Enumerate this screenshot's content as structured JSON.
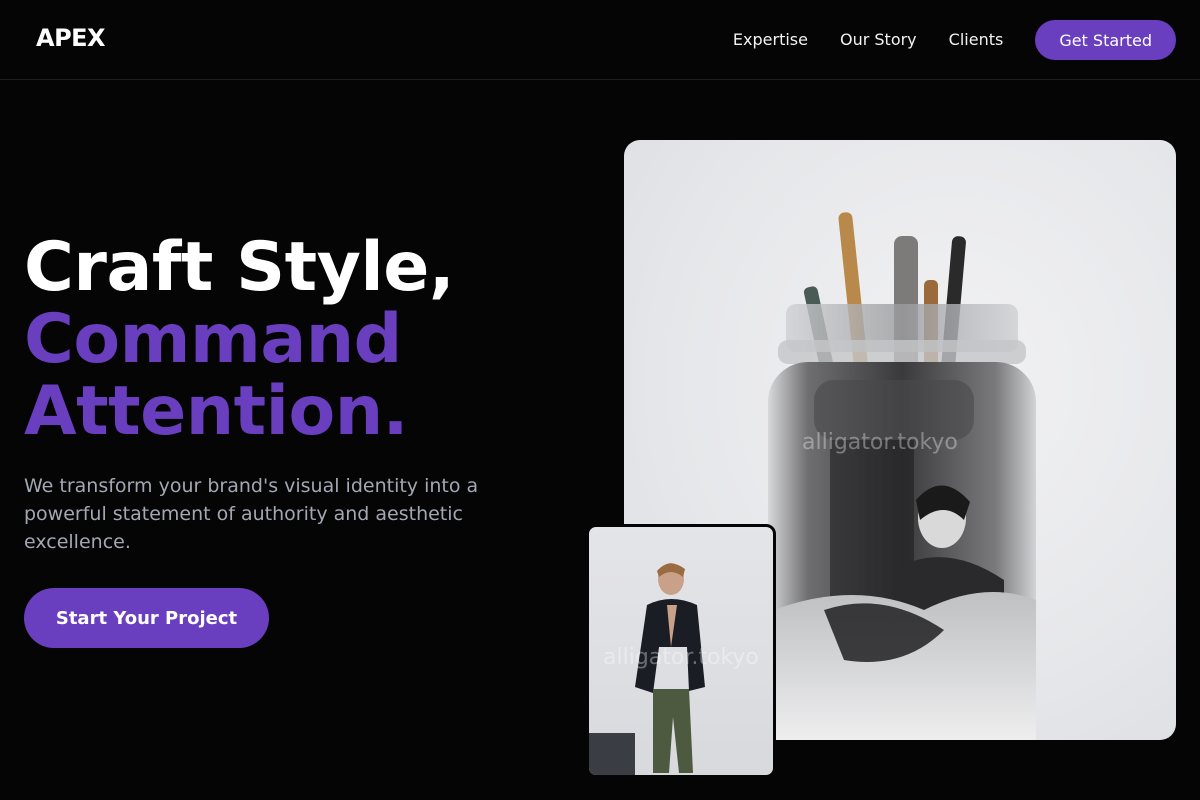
{
  "nav": {
    "logo": "APEX",
    "links": [
      "Expertise",
      "Our Story",
      "Clients"
    ],
    "cta": "Get Started"
  },
  "hero": {
    "title_line1": "Craft Style,",
    "title_line2": "Command",
    "title_line3": "Attention.",
    "description": "We transform your brand's visual identity into a powerful statement of authority and aesthetic excellence.",
    "cta": "Start Your Project"
  },
  "images": {
    "main_watermark": "alligator.tokyo",
    "small_watermark": "alligator.tokyo"
  },
  "colors": {
    "accent": "#6a3fbf",
    "background": "#050505",
    "muted_text": "#a3a7b3"
  }
}
